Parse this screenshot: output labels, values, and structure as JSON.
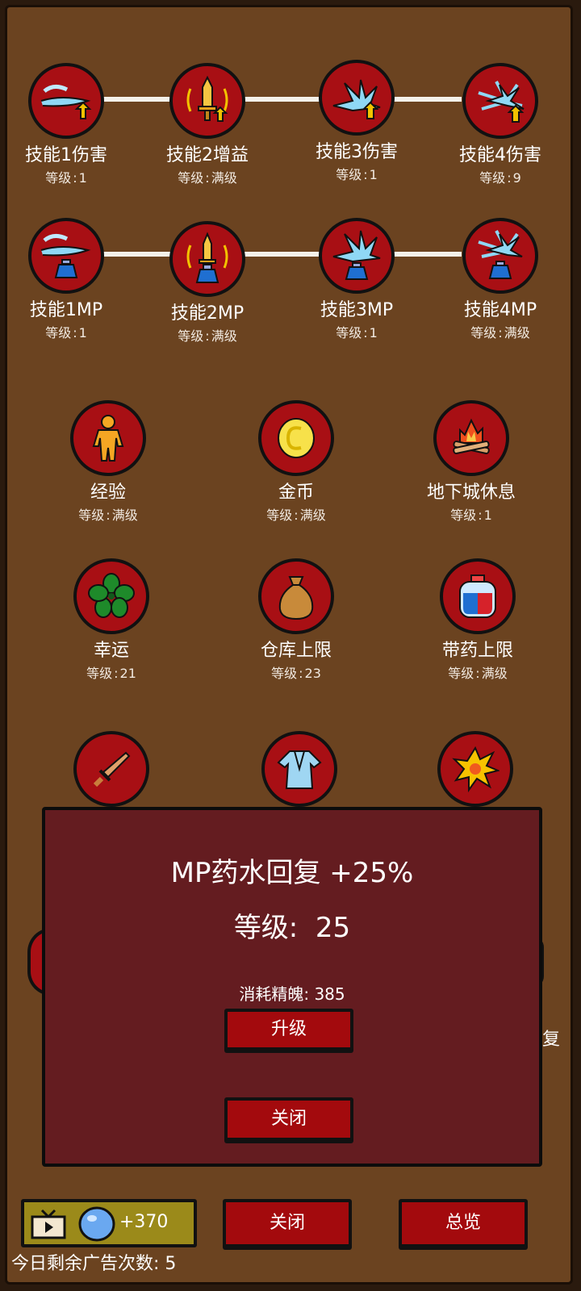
{
  "level_prefix": "等级",
  "level_sep": ":",
  "skills_row1": [
    {
      "name": "技能1伤害",
      "level": "1",
      "icon": "wind-dmg-icon"
    },
    {
      "name": "技能2增益",
      "level": "满级",
      "icon": "sword-buff-icon"
    },
    {
      "name": "技能3伤害",
      "level": "1",
      "icon": "spikes-dmg-icon"
    },
    {
      "name": "技能4伤害",
      "level": "9",
      "icon": "burst-dmg-icon"
    }
  ],
  "skills_row2": [
    {
      "name": "技能1MP",
      "level": "1",
      "icon": "wind-mp-icon"
    },
    {
      "name": "技能2MP",
      "level": "满级",
      "icon": "sword-mp-icon"
    },
    {
      "name": "技能3MP",
      "level": "1",
      "icon": "spikes-mp-icon"
    },
    {
      "name": "技能4MP",
      "level": "满级",
      "icon": "burst-mp-icon"
    }
  ],
  "upgrades_row3": [
    {
      "name": "经验",
      "level": "满级",
      "icon": "person-icon"
    },
    {
      "name": "金币",
      "level": "满级",
      "icon": "coin-icon"
    },
    {
      "name": "地下城休息",
      "level": "1",
      "icon": "campfire-icon"
    }
  ],
  "upgrades_row4": [
    {
      "name": "幸运",
      "level": "21",
      "icon": "clover-icon"
    },
    {
      "name": "仓库上限",
      "level": "23",
      "icon": "bag-icon"
    },
    {
      "name": "带药上限",
      "level": "满级",
      "icon": "potion-icon"
    }
  ],
  "upgrades_row5_icons": [
    "sword-icon",
    "robe-icon",
    "explosion-icon"
  ],
  "partial_right_text": "复",
  "modal": {
    "title": "MP药水回复 +25%",
    "level_label": "等级:",
    "level_value": "25",
    "cost_label": "消耗精魄:",
    "cost_value": "385",
    "upgrade_button": "升级",
    "close_button": "关闭"
  },
  "footer": {
    "ad_reward": "+370",
    "close_button": "关闭",
    "overview_button": "总览",
    "ads_remaining_label": "今日剩余广告次数:",
    "ads_remaining_value": "5"
  },
  "colors": {
    "board_bg": "#6b4320",
    "circle_red": "#a80f14",
    "modal_bg": "#641c20",
    "button_red": "#a30a0d",
    "ad_bar": "#9b8a1a"
  }
}
